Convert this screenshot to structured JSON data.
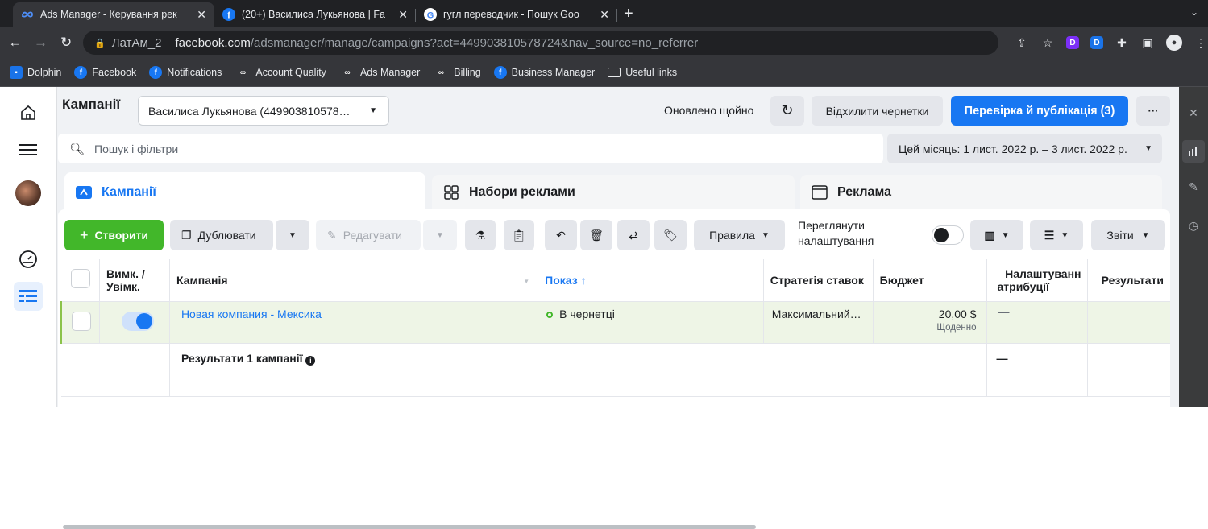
{
  "browser": {
    "tabs": [
      {
        "title": "Ads Manager - Керування рек",
        "icon": "meta-icon"
      },
      {
        "title": "(20+) Василиса Лукьянова | Fa",
        "icon": "facebook-icon"
      },
      {
        "title": "гугл переводчик - Пошук Goo",
        "icon": "google-icon"
      }
    ],
    "url_profile": "ЛатАм_2",
    "url_host": "facebook.com",
    "url_path": "/adsmanager/manage/campaigns?act=449903810578724&nav_source=no_referrer",
    "ext_label_1": "D",
    "ext_label_2": "D",
    "bookmarks": [
      "Dolphin",
      "Facebook",
      "Notifications",
      "Account Quality",
      "Ads Manager",
      "Billing",
      "Business Manager",
      "Useful links"
    ]
  },
  "header": {
    "title": "Кампанії",
    "account": "Василиса Лукьянова (449903810578…",
    "updated": "Оновлено щойно",
    "discard_label": "Відхилити чернетки",
    "publish_label": "Перевірка й публікація (3)",
    "more_label": "···"
  },
  "filters": {
    "search_placeholder": "Пошук і фільтри",
    "date_range": "Цей місяць: 1 лист. 2022 р. – 3 лист. 2022 р."
  },
  "level_tabs": [
    {
      "label": "Кампанії"
    },
    {
      "label": "Набори реклами"
    },
    {
      "label": "Реклама"
    }
  ],
  "actions": {
    "create": "Створити",
    "duplicate": "Дублювати",
    "edit": "Редагувати",
    "rules": "Правила",
    "view_settings_line1": "Переглянути",
    "view_settings_line2": "налаштування",
    "reports": "Звіти"
  },
  "table": {
    "headers": {
      "toggle_line1": "Вимк. /",
      "toggle_line2": "Увімк.",
      "campaign": "Кампанія",
      "delivery": "Показ ↑",
      "bid_strategy": "Стратегія ставок",
      "budget": "Бюджет",
      "attribution_line1": "Налаштуванн",
      "attribution_line2": "атрибуції",
      "results": "Результати"
    },
    "rows": [
      {
        "campaign": "Новая компания - Мексика",
        "delivery": "В чернетці",
        "bid_strategy": "Максимальний…",
        "budget": "20,00 $",
        "budget_period": "Щоденно",
        "attribution": "—"
      }
    ],
    "summary": {
      "label": "Результати 1 кампанії",
      "attribution": "—"
    }
  }
}
